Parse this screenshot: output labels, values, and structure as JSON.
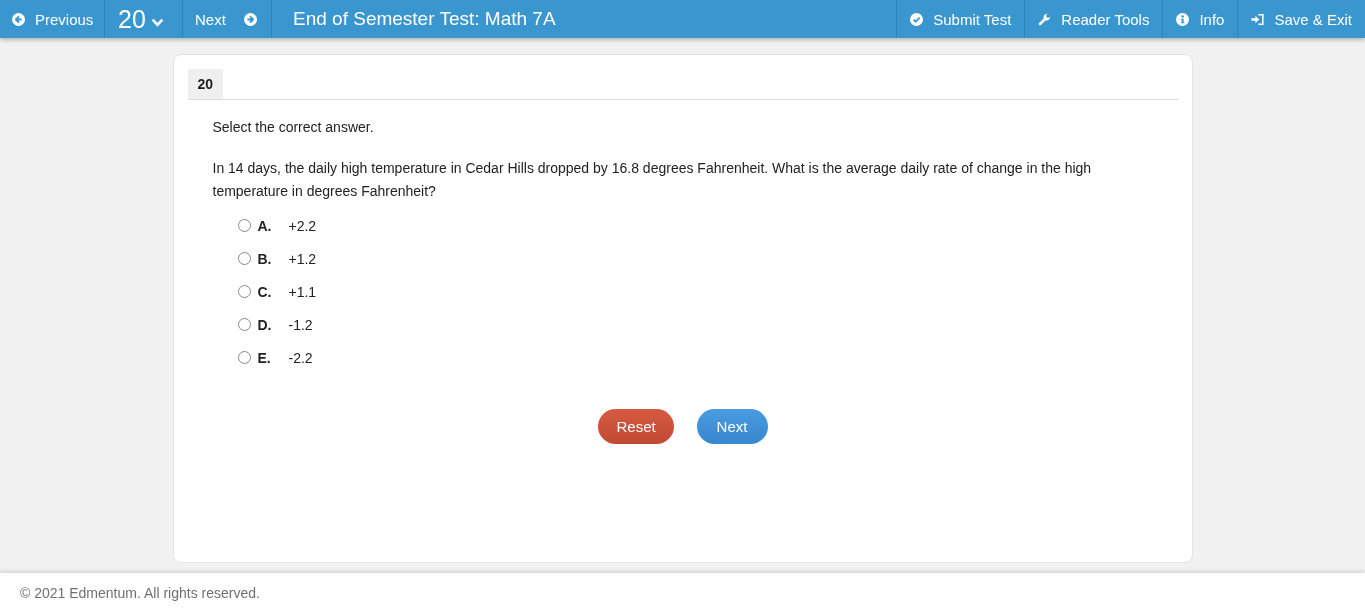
{
  "top_bar": {
    "previous": {
      "label": "Previous"
    },
    "question_selector": {
      "label": "20"
    },
    "next": {
      "label": "Next"
    },
    "title": "End of Semester Test: Math 7A",
    "actions": [
      {
        "kind": "submit",
        "label": "Submit Test"
      },
      {
        "kind": "tools",
        "label": "Reader Tools"
      },
      {
        "kind": "info",
        "label": "Info"
      },
      {
        "kind": "exit",
        "label": "Save & Exit"
      }
    ]
  },
  "question": {
    "number": "20",
    "instruction": "Select the correct answer.",
    "text": "In 14 days, the daily high temperature in Cedar Hills dropped by 16.8 degrees Fahrenheit. What is the average daily rate of change in the high temperature in degrees Fahrenheit?",
    "options": [
      {
        "letter": "A.",
        "value": "+2.2",
        "selected": false
      },
      {
        "letter": "B.",
        "value": "+1.2",
        "selected": false
      },
      {
        "letter": "C.",
        "value": "+1.1",
        "selected": false
      },
      {
        "letter": "D.",
        "value": "-1.2",
        "selected": false
      },
      {
        "letter": "E.",
        "value": "-2.2",
        "selected": false
      }
    ],
    "buttons": [
      {
        "kind": "reset",
        "label": "Reset"
      },
      {
        "kind": "next",
        "label": "Next"
      }
    ]
  },
  "footer": {
    "text": "© 2021 Edmentum. All rights reserved."
  }
}
